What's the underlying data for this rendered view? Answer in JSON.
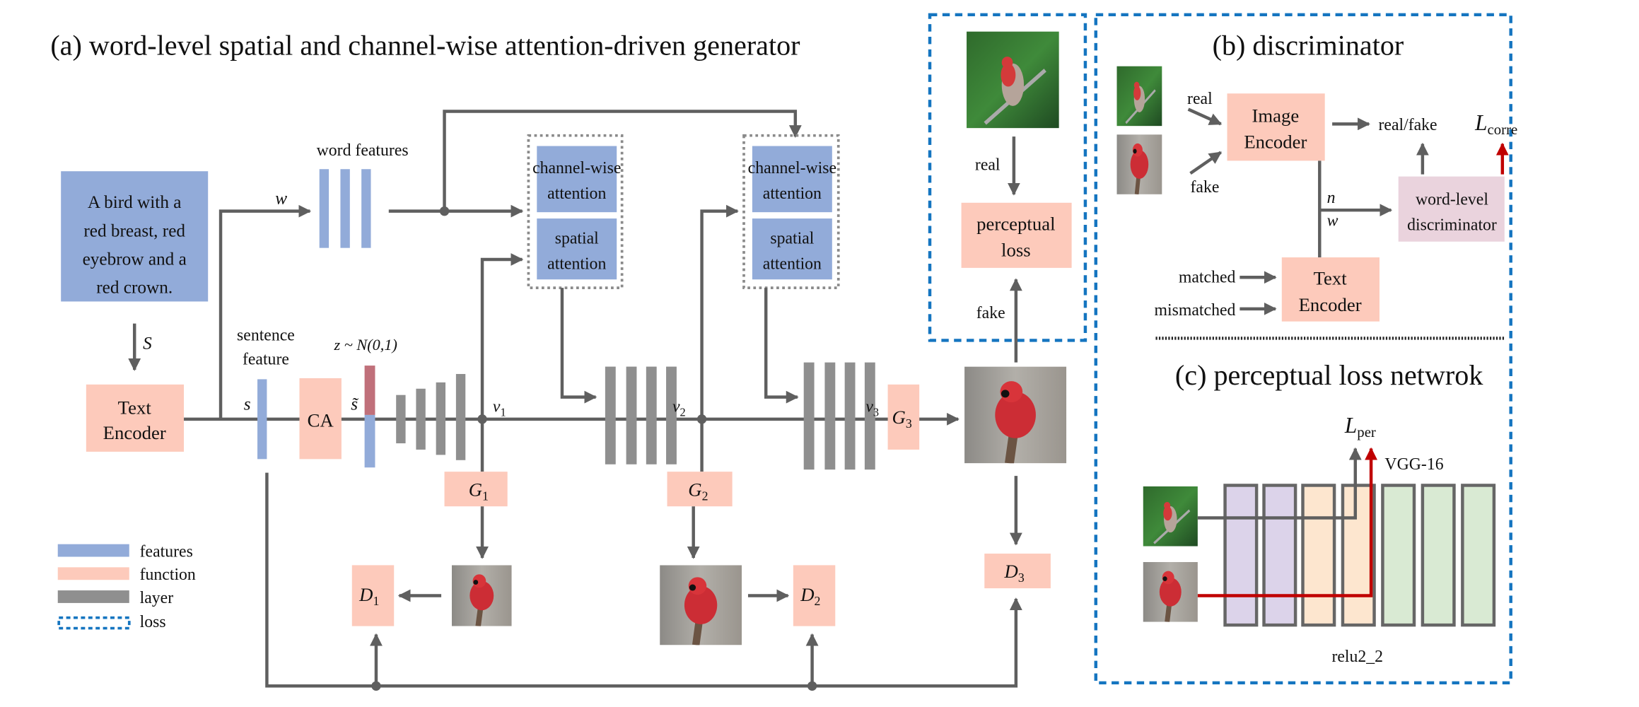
{
  "colors": {
    "features": "#92abd9",
    "function": "#fdcabb",
    "layer": "#8f8f8f",
    "loss": "#1575c0",
    "arrow": "#5f5f5f",
    "loss_arrow": "#c00000",
    "word_disc": "#ead3dd"
  },
  "generator": {
    "title": "(a) word-level spatial and channel-wise attention-driven generator",
    "text_input": [
      "A bird with a",
      "red breast, red",
      "eyebrow and a",
      "red crown."
    ],
    "S_label": "S",
    "text_encoder": [
      "Text",
      "Encoder"
    ],
    "w_label": "w",
    "word_features_label": "word features",
    "sentence_feature_label": [
      "sentence",
      "feature"
    ],
    "s_label": "s",
    "s_tilde_label": "s̃",
    "ca_label": "CA",
    "z_label": "z ~ N(0,1)",
    "attention_blocks": [
      {
        "channel": [
          "channel-wise",
          "attention"
        ],
        "spatial": [
          "spatial",
          "attention"
        ]
      },
      {
        "channel": [
          "channel-wise",
          "attention"
        ],
        "spatial": [
          "spatial",
          "attention"
        ]
      }
    ],
    "v_labels": [
      {
        "base": "v",
        "sub": "1"
      },
      {
        "base": "v",
        "sub": "2"
      },
      {
        "base": "v",
        "sub": "3"
      }
    ],
    "G_labels": [
      {
        "base": "G",
        "sub": "1"
      },
      {
        "base": "G",
        "sub": "2"
      },
      {
        "base": "G",
        "sub": "3"
      }
    ],
    "D_labels": [
      {
        "base": "D",
        "sub": "1"
      },
      {
        "base": "D",
        "sub": "2"
      },
      {
        "base": "D",
        "sub": "3"
      }
    ]
  },
  "perceptual": {
    "real_label": "real",
    "fake_label": "fake",
    "box": [
      "perceptual",
      "loss"
    ]
  },
  "legend": [
    {
      "label": "features",
      "kind": "features"
    },
    {
      "label": "function",
      "kind": "function"
    },
    {
      "label": "layer",
      "kind": "layer"
    },
    {
      "label": "loss",
      "kind": "loss"
    }
  ],
  "discriminator": {
    "title": "(b) discriminator",
    "real_label": "real",
    "fake_label": "fake",
    "image_encoder": [
      "Image",
      "Encoder"
    ],
    "output_label": "real/fake",
    "loss_label": {
      "base": "L",
      "sub": "corre"
    },
    "n_label": "n",
    "w_label": "w",
    "word_disc": [
      "word-level",
      "discriminator"
    ],
    "matched_label": "matched",
    "mismatched_label": "mismatched",
    "text_encoder": [
      "Text",
      "Encoder"
    ]
  },
  "perceptual_network": {
    "title": "(c) perceptual loss netwrok",
    "loss_label": {
      "base": "L",
      "sub": "per"
    },
    "network_label": "VGG-16",
    "layer_label": "relu2_2",
    "layer_colors": [
      "#dcd3ea",
      "#dcd3ea",
      "#fde6cf",
      "#fde6cf",
      "#d9ead3",
      "#d9ead3",
      "#d9ead3"
    ]
  }
}
